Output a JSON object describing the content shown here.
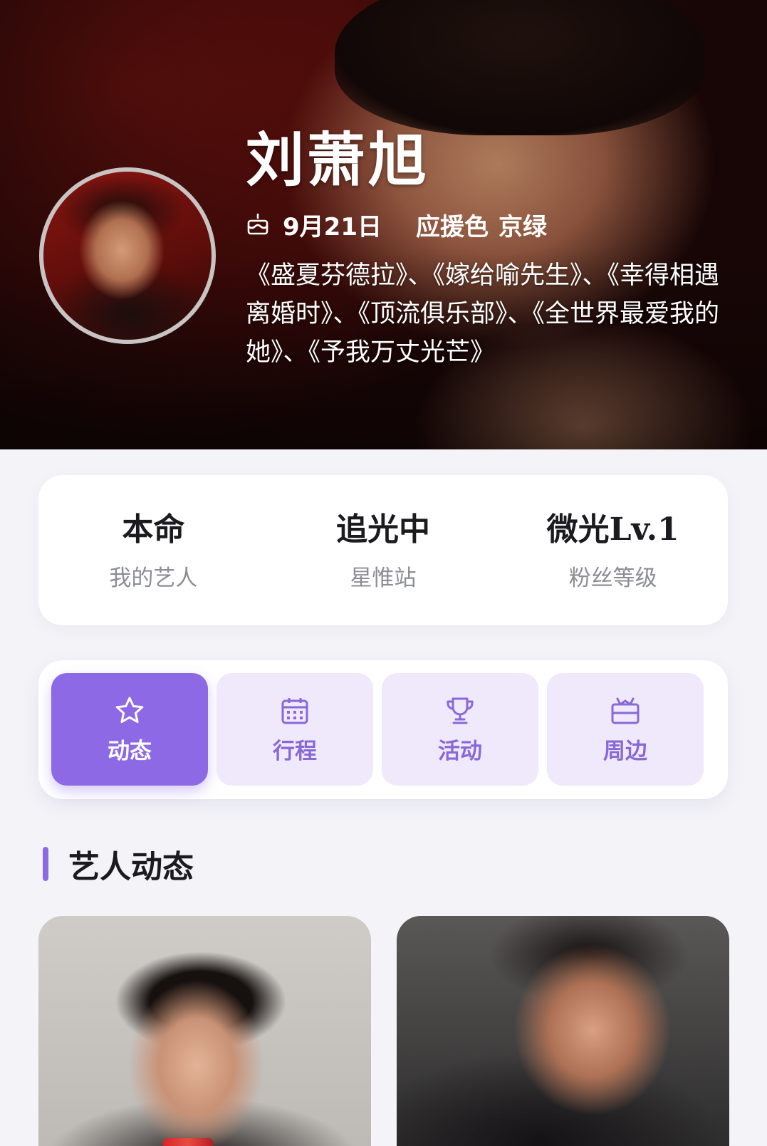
{
  "artist": {
    "name": "刘萧旭",
    "birthday": "9月21日",
    "support_color_label": "应援色",
    "support_color": "京绿",
    "works": "《盛夏芬德拉》、《嫁给喻先生》、《幸得相遇离婚时》、《顶流俱乐部》、《全世界最爱我的她》、《予我万丈光芒》"
  },
  "stats": [
    {
      "value": "本命",
      "label": "我的艺人"
    },
    {
      "value": "追光中",
      "label": "星惟站"
    },
    {
      "value": "微光Lv.1",
      "label": "粉丝等级"
    }
  ],
  "tabs": [
    {
      "label": "动态",
      "icon": "star-icon",
      "active": true
    },
    {
      "label": "行程",
      "icon": "calendar-icon",
      "active": false
    },
    {
      "label": "活动",
      "icon": "trophy-icon",
      "active": false
    },
    {
      "label": "周边",
      "icon": "gift-icon",
      "active": false
    }
  ],
  "section": {
    "title": "艺人动态"
  },
  "colors": {
    "accent": "#8d69e6",
    "accent_light": "#efe9fb",
    "background": "#f3f3f8",
    "hero_red": "#6e1210"
  }
}
